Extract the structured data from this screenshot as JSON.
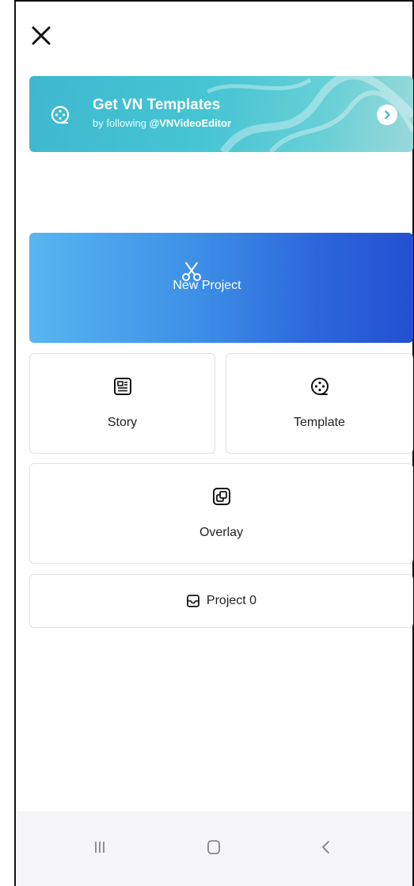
{
  "banner": {
    "title": "Get VN Templates",
    "subtitle_prefix": "by following",
    "handle": "@VNVideoEditor",
    "icon": "film-reel-icon",
    "arrow_icon": "chevron-right-icon"
  },
  "new_project": {
    "label": "New Project",
    "icon": "scissors-icon"
  },
  "cards": {
    "story": {
      "label": "Story",
      "icon": "document-icon"
    },
    "template": {
      "label": "Template",
      "icon": "film-reel-icon"
    },
    "overlay": {
      "label": "Overlay",
      "icon": "overlay-icon"
    }
  },
  "projects": {
    "label": "Project 0",
    "icon": "tray-icon"
  },
  "system_nav": {
    "recents": "recents-icon",
    "home": "home-icon",
    "back": "back-icon"
  },
  "colors": {
    "banner_start": "#3fb8cf",
    "new_project_start": "#58b6f0",
    "new_project_end": "#2450d0",
    "card_border": "#e2e2e2",
    "navbar_bg": "#f5f5f7"
  }
}
